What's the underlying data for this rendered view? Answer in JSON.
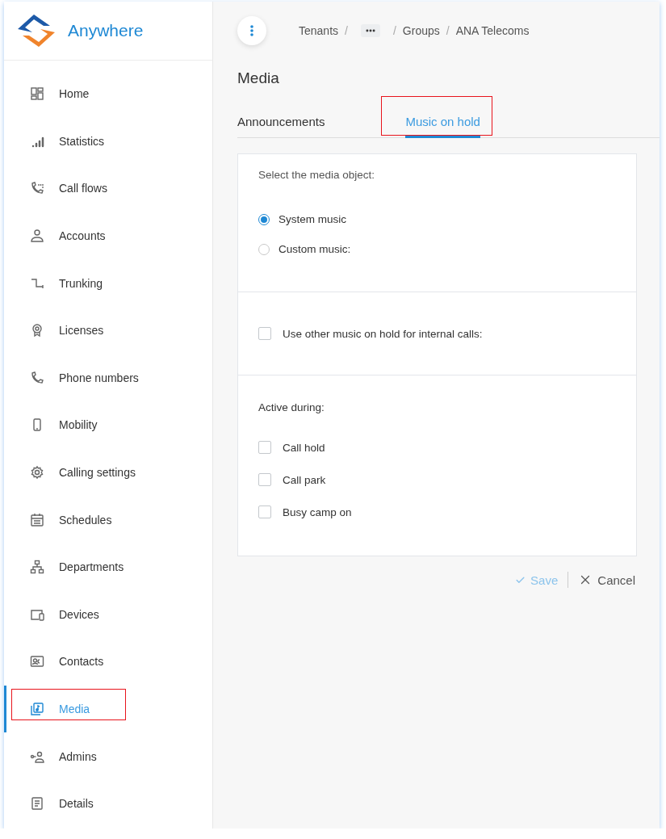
{
  "brand": {
    "name": "Anywhere"
  },
  "sidebar": {
    "items": [
      {
        "label": "Home",
        "selected": false,
        "highlighted": false
      },
      {
        "label": "Statistics",
        "selected": false,
        "highlighted": false
      },
      {
        "label": "Call flows",
        "selected": false,
        "highlighted": false
      },
      {
        "label": "Accounts",
        "selected": false,
        "highlighted": false
      },
      {
        "label": "Trunking",
        "selected": false,
        "highlighted": false
      },
      {
        "label": "Licenses",
        "selected": false,
        "highlighted": false
      },
      {
        "label": "Phone numbers",
        "selected": false,
        "highlighted": false
      },
      {
        "label": "Mobility",
        "selected": false,
        "highlighted": false
      },
      {
        "label": "Calling settings",
        "selected": false,
        "highlighted": false
      },
      {
        "label": "Schedules",
        "selected": false,
        "highlighted": false
      },
      {
        "label": "Departments",
        "selected": false,
        "highlighted": false
      },
      {
        "label": "Devices",
        "selected": false,
        "highlighted": false
      },
      {
        "label": "Contacts",
        "selected": false,
        "highlighted": false
      },
      {
        "label": "Media",
        "selected": true,
        "highlighted": true
      },
      {
        "label": "Admins",
        "selected": false,
        "highlighted": false
      },
      {
        "label": "Details",
        "selected": false,
        "highlighted": false
      }
    ]
  },
  "breadcrumb": {
    "separator": "/",
    "items": [
      {
        "kind": "link",
        "label": "Tenants"
      },
      {
        "kind": "more"
      },
      {
        "kind": "link",
        "label": "Groups"
      },
      {
        "kind": "link",
        "label": "ANA Telecoms"
      }
    ]
  },
  "page": {
    "title": "Media"
  },
  "tabs": [
    {
      "label": "Announcements",
      "selected": false,
      "highlighted": false
    },
    {
      "label": "Music on hold",
      "selected": true,
      "highlighted": true
    }
  ],
  "media_object": {
    "label": "Select the media object:",
    "options": [
      {
        "label": "System music",
        "selected": true
      },
      {
        "label": "Custom music:",
        "selected": false
      }
    ]
  },
  "internal_calls": {
    "label": "Use other music on hold for internal calls:",
    "checked": false
  },
  "active_during": {
    "label": "Active during:",
    "options": [
      {
        "label": "Call hold",
        "checked": false
      },
      {
        "label": "Call park",
        "checked": false
      },
      {
        "label": "Busy camp on",
        "checked": false
      }
    ]
  },
  "actions": {
    "save": {
      "label": "Save",
      "disabled": true
    },
    "cancel": {
      "label": "Cancel"
    }
  }
}
